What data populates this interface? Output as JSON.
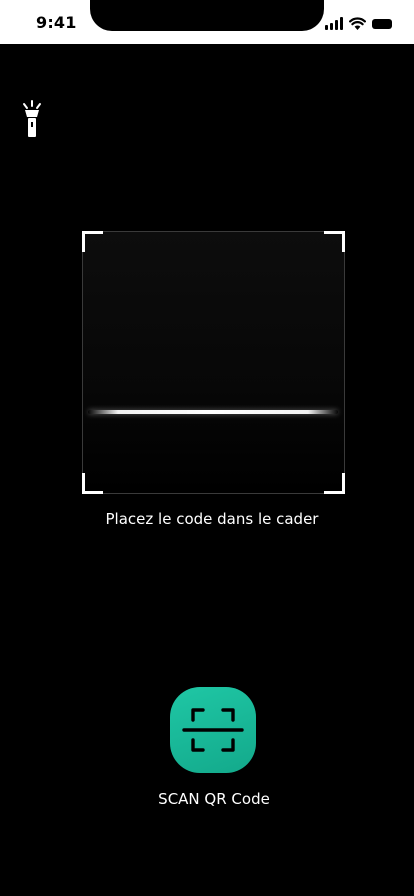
{
  "status_bar": {
    "time": "9:41"
  },
  "toolbar": {
    "flashlight_icon": "flashlight-icon"
  },
  "scanner": {
    "instruction": "Placez le code dans le cader"
  },
  "scan_button": {
    "icon": "qr-scan-icon",
    "label": "SCAN QR Code",
    "color": "#1ab99a"
  },
  "colors": {
    "background": "#000000",
    "status_bar": "#ffffff",
    "accent": "#1ab99a"
  }
}
